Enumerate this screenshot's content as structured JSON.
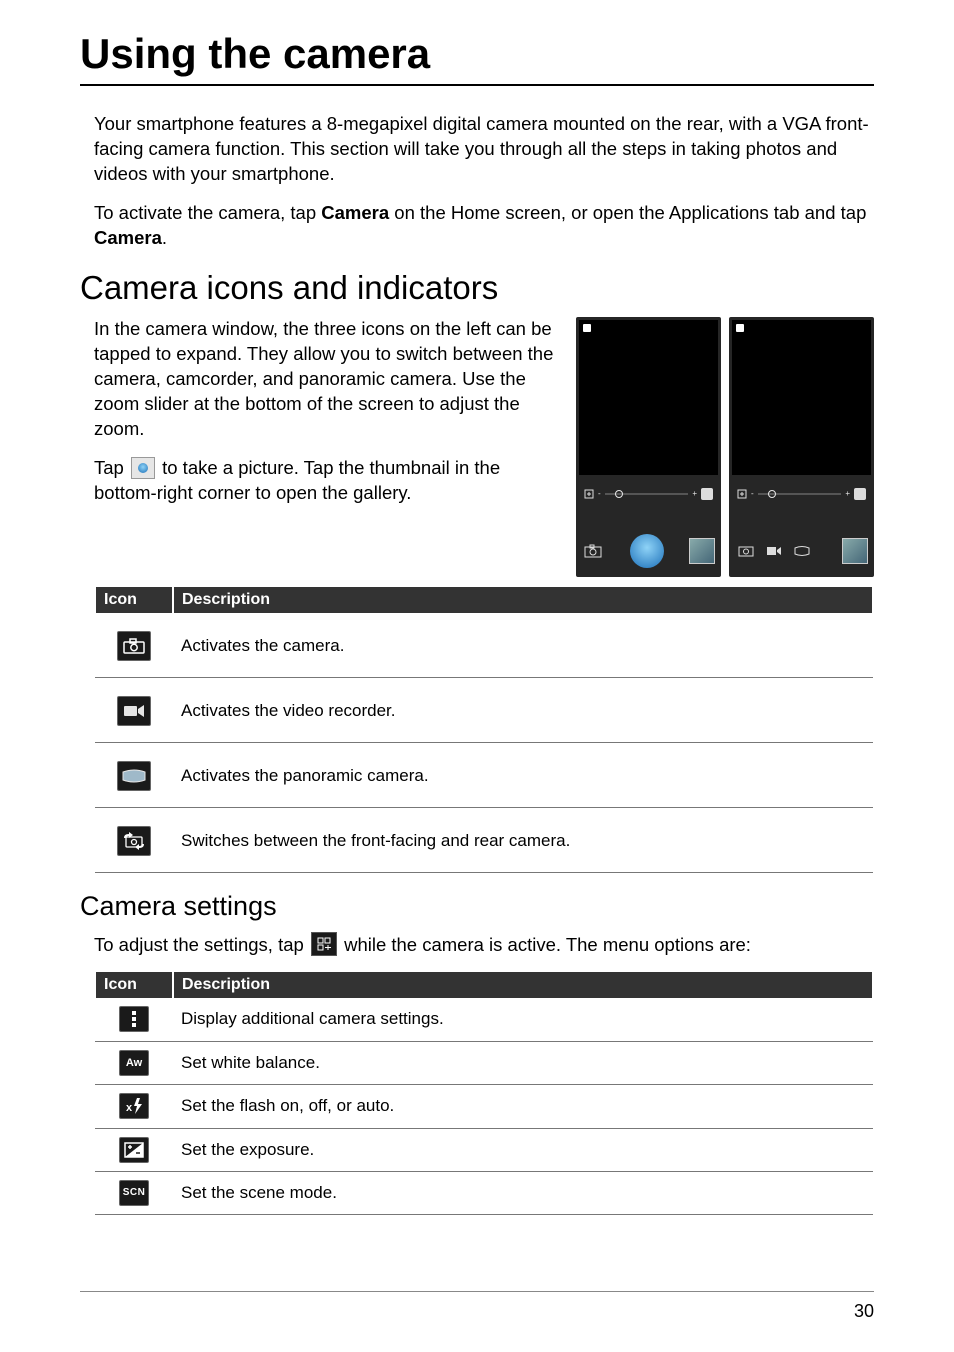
{
  "page": {
    "title": "Using the camera",
    "number": "30"
  },
  "intro": {
    "p1_a": "Your smartphone features a 8-megapixel digital camera mounted on the rear, with a VGA front-facing camera function. This section will take you through all the steps in taking photos and videos with your smartphone.",
    "p2_a": "To activate the camera, tap ",
    "p2_b_bold": "Camera",
    "p2_c": " on the Home screen, or open the Applications tab and tap ",
    "p2_d_bold": "Camera",
    "p2_e": "."
  },
  "section1": {
    "heading": "Camera icons and indicators",
    "p1": "In the camera window, the three icons on the left can be tapped to expand. They allow you to switch between the camera, camcorder, and panoramic camera. Use the zoom slider at the bottom of the screen to adjust the zoom.",
    "p2_a": "Tap ",
    "p2_b": " to take a picture. Tap the thumbnail in the bottom-right corner to open the gallery."
  },
  "table1": {
    "headers": {
      "icon": "Icon",
      "desc": "Description"
    },
    "rows": [
      {
        "icon_name": "camera-mode-icon",
        "desc": "Activates the camera."
      },
      {
        "icon_name": "video-mode-icon",
        "desc": "Activates the video recorder."
      },
      {
        "icon_name": "panorama-mode-icon",
        "desc": "Activates the panoramic camera."
      },
      {
        "icon_name": "switch-camera-icon",
        "desc": "Switches between the front-facing and rear camera."
      }
    ]
  },
  "section2": {
    "heading": "Camera settings",
    "p1_a": "To adjust the settings, tap ",
    "p1_b": " while the camera is active. The menu options are:"
  },
  "table2": {
    "headers": {
      "icon": "Icon",
      "desc": "Description"
    },
    "rows": [
      {
        "icon_name": "overflow-settings-icon",
        "desc": "Display additional camera settings."
      },
      {
        "icon_name": "white-balance-icon",
        "desc": "Set white balance."
      },
      {
        "icon_name": "flash-setting-icon",
        "desc": "Set the flash on, off, or auto."
      },
      {
        "icon_name": "exposure-setting-icon",
        "desc": "Set the exposure."
      },
      {
        "icon_name": "scene-mode-icon",
        "desc": "Set the scene mode."
      }
    ]
  },
  "icons": {
    "scn_label": "SCN",
    "aw_label": "Aw"
  }
}
